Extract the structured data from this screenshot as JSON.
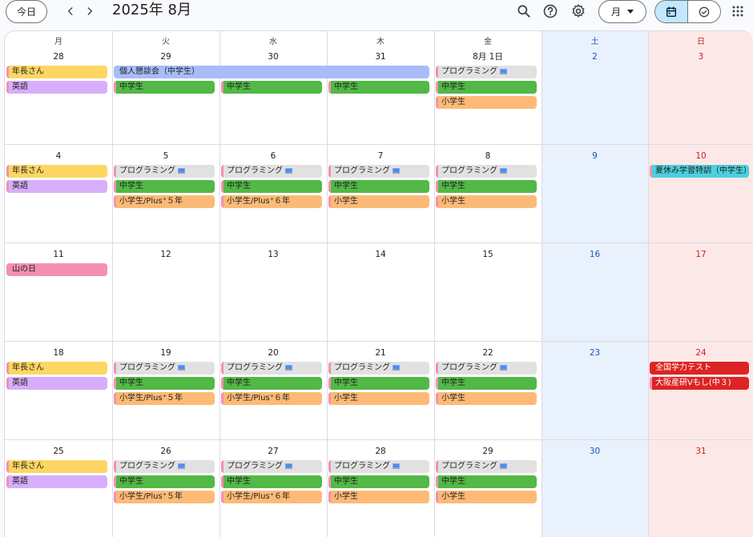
{
  "header": {
    "today_label": "今日",
    "title": "2025年 8月",
    "view_label": "月",
    "icons": [
      "search-icon",
      "help-icon",
      "settings-icon",
      "apps-icon",
      "calendar-icon",
      "tasks-icon"
    ]
  },
  "colors": {
    "yellow": "#fdd663",
    "lavender": "#d7aefb",
    "periwinkle": "#a7bcf9",
    "green": "#52b846",
    "orange": "#fdba77",
    "gray": "#e1e1e1",
    "pink": "#f48fb1",
    "cyan": "#4ccfde",
    "red": "#dd2424",
    "sat_bg": "#e8f1fc",
    "sun_bg": "#fde8e8"
  },
  "weekdays": [
    "月",
    "火",
    "水",
    "木",
    "金",
    "土",
    "日"
  ],
  "weeks": [
    {
      "days": [
        "28",
        "29",
        "30",
        "31",
        "8月 1日",
        "2",
        "3"
      ],
      "events": [
        {
          "label": "年長さん",
          "col": 0,
          "span": 1,
          "row": 0,
          "color": "yellow",
          "stripe": "pink"
        },
        {
          "label": "英語",
          "col": 0,
          "span": 1,
          "row": 1,
          "color": "lavender",
          "stripe": "pink"
        },
        {
          "label": "個人懇談会（中学生）",
          "col": 1,
          "span": 3,
          "row": 0,
          "color": "periwinkle",
          "stripe": "periwinkle"
        },
        {
          "label": "中学生",
          "col": 1,
          "span": 1,
          "row": 1,
          "color": "green",
          "stripe": "pink"
        },
        {
          "label": "中学生",
          "col": 2,
          "span": 1,
          "row": 1,
          "color": "green",
          "stripe": "pink"
        },
        {
          "label": "中学生",
          "col": 3,
          "span": 1,
          "row": 1,
          "color": "green",
          "stripe": "pink"
        },
        {
          "label": "プログラミング",
          "col": 4,
          "span": 1,
          "row": 0,
          "color": "gray",
          "stripe": "pink",
          "icon": true
        },
        {
          "label": "中学生",
          "col": 4,
          "span": 1,
          "row": 1,
          "color": "green",
          "stripe": "pink"
        },
        {
          "label": "小学生",
          "col": 4,
          "span": 1,
          "row": 2,
          "color": "orange",
          "stripe": "pink"
        }
      ]
    },
    {
      "days": [
        "4",
        "5",
        "6",
        "7",
        "8",
        "9",
        "10"
      ],
      "events": [
        {
          "label": "年長さん",
          "col": 0,
          "span": 1,
          "row": 0,
          "color": "yellow",
          "stripe": "pink"
        },
        {
          "label": "英語",
          "col": 0,
          "span": 1,
          "row": 1,
          "color": "lavender",
          "stripe": "pink"
        },
        {
          "label": "プログラミング",
          "col": 1,
          "span": 1,
          "row": 0,
          "color": "gray",
          "stripe": "pink",
          "icon": true
        },
        {
          "label": "中学生",
          "col": 1,
          "span": 1,
          "row": 1,
          "color": "green",
          "stripe": "pink"
        },
        {
          "label": "小学生/Plus⁺５年",
          "col": 1,
          "span": 1,
          "row": 2,
          "color": "orange",
          "stripe": "pink"
        },
        {
          "label": "プログラミング",
          "col": 2,
          "span": 1,
          "row": 0,
          "color": "gray",
          "stripe": "pink",
          "icon": true
        },
        {
          "label": "中学生",
          "col": 2,
          "span": 1,
          "row": 1,
          "color": "green",
          "stripe": "pink"
        },
        {
          "label": "小学生/Plus⁺６年",
          "col": 2,
          "span": 1,
          "row": 2,
          "color": "orange",
          "stripe": "pink"
        },
        {
          "label": "プログラミング",
          "col": 3,
          "span": 1,
          "row": 0,
          "color": "gray",
          "stripe": "pink",
          "icon": true
        },
        {
          "label": "中学生",
          "col": 3,
          "span": 1,
          "row": 1,
          "color": "green",
          "stripe": "pink"
        },
        {
          "label": "小学生",
          "col": 3,
          "span": 1,
          "row": 2,
          "color": "orange",
          "stripe": "pink"
        },
        {
          "label": "プログラミング",
          "col": 4,
          "span": 1,
          "row": 0,
          "color": "gray",
          "stripe": "pink",
          "icon": true
        },
        {
          "label": "中学生",
          "col": 4,
          "span": 1,
          "row": 1,
          "color": "green",
          "stripe": "pink"
        },
        {
          "label": "小学生",
          "col": 4,
          "span": 1,
          "row": 2,
          "color": "orange",
          "stripe": "pink"
        },
        {
          "label": "夏休み学習特訓（中学生）",
          "col": 6,
          "span": 1,
          "row": 0,
          "color": "cyan",
          "stripe": "pink"
        }
      ]
    },
    {
      "days": [
        "11",
        "12",
        "13",
        "14",
        "15",
        "16",
        "17"
      ],
      "events": [
        {
          "label": "山の日",
          "col": 0,
          "span": 1,
          "row": 0,
          "color": "pink",
          "stripe": "pink"
        }
      ]
    },
    {
      "days": [
        "18",
        "19",
        "20",
        "21",
        "22",
        "23",
        "24"
      ],
      "events": [
        {
          "label": "年長さん",
          "col": 0,
          "span": 1,
          "row": 0,
          "color": "yellow",
          "stripe": "pink"
        },
        {
          "label": "英語",
          "col": 0,
          "span": 1,
          "row": 1,
          "color": "lavender",
          "stripe": "pink"
        },
        {
          "label": "プログラミング",
          "col": 1,
          "span": 1,
          "row": 0,
          "color": "gray",
          "stripe": "pink",
          "icon": true
        },
        {
          "label": "中学生",
          "col": 1,
          "span": 1,
          "row": 1,
          "color": "green",
          "stripe": "pink"
        },
        {
          "label": "小学生/Plus⁺５年",
          "col": 1,
          "span": 1,
          "row": 2,
          "color": "orange",
          "stripe": "pink"
        },
        {
          "label": "プログラミング",
          "col": 2,
          "span": 1,
          "row": 0,
          "color": "gray",
          "stripe": "pink",
          "icon": true
        },
        {
          "label": "中学生",
          "col": 2,
          "span": 1,
          "row": 1,
          "color": "green",
          "stripe": "pink"
        },
        {
          "label": "小学生/Plus⁺６年",
          "col": 2,
          "span": 1,
          "row": 2,
          "color": "orange",
          "stripe": "pink"
        },
        {
          "label": "プログラミング",
          "col": 3,
          "span": 1,
          "row": 0,
          "color": "gray",
          "stripe": "pink",
          "icon": true
        },
        {
          "label": "中学生",
          "col": 3,
          "span": 1,
          "row": 1,
          "color": "green",
          "stripe": "pink"
        },
        {
          "label": "小学生",
          "col": 3,
          "span": 1,
          "row": 2,
          "color": "orange",
          "stripe": "pink"
        },
        {
          "label": "プログラミング",
          "col": 4,
          "span": 1,
          "row": 0,
          "color": "gray",
          "stripe": "pink",
          "icon": true
        },
        {
          "label": "中学生",
          "col": 4,
          "span": 1,
          "row": 1,
          "color": "green",
          "stripe": "pink"
        },
        {
          "label": "小学生",
          "col": 4,
          "span": 1,
          "row": 2,
          "color": "orange",
          "stripe": "pink"
        },
        {
          "label": "全国学力テスト",
          "col": 6,
          "span": 1,
          "row": 0,
          "color": "red",
          "stripe": "red",
          "white": true
        },
        {
          "label": "大阪産研Vもし(中３)",
          "col": 6,
          "span": 1,
          "row": 1,
          "color": "red",
          "stripe": "pink",
          "white": true
        }
      ]
    },
    {
      "days": [
        "25",
        "26",
        "27",
        "28",
        "29",
        "30",
        "31"
      ],
      "events": [
        {
          "label": "年長さん",
          "col": 0,
          "span": 1,
          "row": 0,
          "color": "yellow",
          "stripe": "pink"
        },
        {
          "label": "英語",
          "col": 0,
          "span": 1,
          "row": 1,
          "color": "lavender",
          "stripe": "pink"
        },
        {
          "label": "プログラミング",
          "col": 1,
          "span": 1,
          "row": 0,
          "color": "gray",
          "stripe": "pink",
          "icon": true
        },
        {
          "label": "中学生",
          "col": 1,
          "span": 1,
          "row": 1,
          "color": "green",
          "stripe": "pink"
        },
        {
          "label": "小学生/Plus⁺５年",
          "col": 1,
          "span": 1,
          "row": 2,
          "color": "orange",
          "stripe": "pink"
        },
        {
          "label": "プログラミング",
          "col": 2,
          "span": 1,
          "row": 0,
          "color": "gray",
          "stripe": "pink",
          "icon": true
        },
        {
          "label": "中学生",
          "col": 2,
          "span": 1,
          "row": 1,
          "color": "green",
          "stripe": "pink"
        },
        {
          "label": "小学生/Plus⁺６年",
          "col": 2,
          "span": 1,
          "row": 2,
          "color": "orange",
          "stripe": "pink"
        },
        {
          "label": "プログラミング",
          "col": 3,
          "span": 1,
          "row": 0,
          "color": "gray",
          "stripe": "pink",
          "icon": true
        },
        {
          "label": "中学生",
          "col": 3,
          "span": 1,
          "row": 1,
          "color": "green",
          "stripe": "pink"
        },
        {
          "label": "小学生",
          "col": 3,
          "span": 1,
          "row": 2,
          "color": "orange",
          "stripe": "pink"
        },
        {
          "label": "プログラミング",
          "col": 4,
          "span": 1,
          "row": 0,
          "color": "gray",
          "stripe": "pink",
          "icon": true
        },
        {
          "label": "中学生",
          "col": 4,
          "span": 1,
          "row": 1,
          "color": "green",
          "stripe": "pink"
        },
        {
          "label": "小学生",
          "col": 4,
          "span": 1,
          "row": 2,
          "color": "orange",
          "stripe": "pink"
        }
      ]
    }
  ]
}
